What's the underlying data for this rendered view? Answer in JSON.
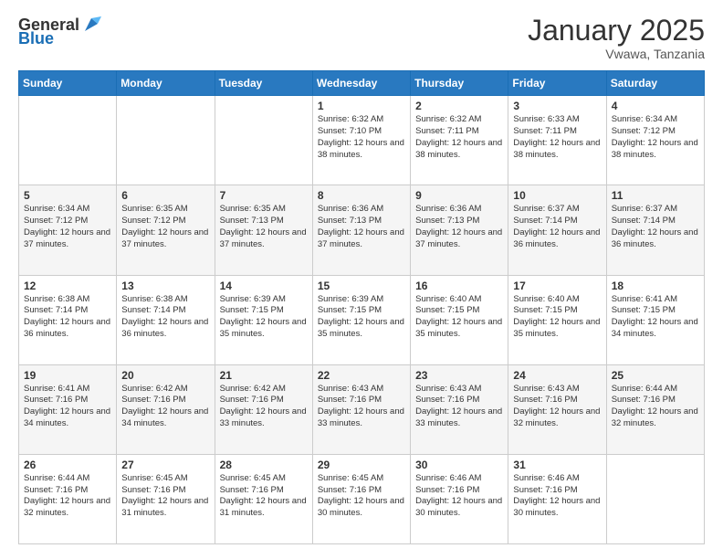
{
  "header": {
    "logo_general": "General",
    "logo_blue": "Blue",
    "month_title": "January 2025",
    "location": "Vwawa, Tanzania"
  },
  "columns": [
    "Sunday",
    "Monday",
    "Tuesday",
    "Wednesday",
    "Thursday",
    "Friday",
    "Saturday"
  ],
  "weeks": [
    [
      {
        "day": "",
        "info": ""
      },
      {
        "day": "",
        "info": ""
      },
      {
        "day": "",
        "info": ""
      },
      {
        "day": "1",
        "info": "Sunrise: 6:32 AM\nSunset: 7:10 PM\nDaylight: 12 hours and 38 minutes."
      },
      {
        "day": "2",
        "info": "Sunrise: 6:32 AM\nSunset: 7:11 PM\nDaylight: 12 hours and 38 minutes."
      },
      {
        "day": "3",
        "info": "Sunrise: 6:33 AM\nSunset: 7:11 PM\nDaylight: 12 hours and 38 minutes."
      },
      {
        "day": "4",
        "info": "Sunrise: 6:34 AM\nSunset: 7:12 PM\nDaylight: 12 hours and 38 minutes."
      }
    ],
    [
      {
        "day": "5",
        "info": "Sunrise: 6:34 AM\nSunset: 7:12 PM\nDaylight: 12 hours and 37 minutes."
      },
      {
        "day": "6",
        "info": "Sunrise: 6:35 AM\nSunset: 7:12 PM\nDaylight: 12 hours and 37 minutes."
      },
      {
        "day": "7",
        "info": "Sunrise: 6:35 AM\nSunset: 7:13 PM\nDaylight: 12 hours and 37 minutes."
      },
      {
        "day": "8",
        "info": "Sunrise: 6:36 AM\nSunset: 7:13 PM\nDaylight: 12 hours and 37 minutes."
      },
      {
        "day": "9",
        "info": "Sunrise: 6:36 AM\nSunset: 7:13 PM\nDaylight: 12 hours and 37 minutes."
      },
      {
        "day": "10",
        "info": "Sunrise: 6:37 AM\nSunset: 7:14 PM\nDaylight: 12 hours and 36 minutes."
      },
      {
        "day": "11",
        "info": "Sunrise: 6:37 AM\nSunset: 7:14 PM\nDaylight: 12 hours and 36 minutes."
      }
    ],
    [
      {
        "day": "12",
        "info": "Sunrise: 6:38 AM\nSunset: 7:14 PM\nDaylight: 12 hours and 36 minutes."
      },
      {
        "day": "13",
        "info": "Sunrise: 6:38 AM\nSunset: 7:14 PM\nDaylight: 12 hours and 36 minutes."
      },
      {
        "day": "14",
        "info": "Sunrise: 6:39 AM\nSunset: 7:15 PM\nDaylight: 12 hours and 35 minutes."
      },
      {
        "day": "15",
        "info": "Sunrise: 6:39 AM\nSunset: 7:15 PM\nDaylight: 12 hours and 35 minutes."
      },
      {
        "day": "16",
        "info": "Sunrise: 6:40 AM\nSunset: 7:15 PM\nDaylight: 12 hours and 35 minutes."
      },
      {
        "day": "17",
        "info": "Sunrise: 6:40 AM\nSunset: 7:15 PM\nDaylight: 12 hours and 35 minutes."
      },
      {
        "day": "18",
        "info": "Sunrise: 6:41 AM\nSunset: 7:15 PM\nDaylight: 12 hours and 34 minutes."
      }
    ],
    [
      {
        "day": "19",
        "info": "Sunrise: 6:41 AM\nSunset: 7:16 PM\nDaylight: 12 hours and 34 minutes."
      },
      {
        "day": "20",
        "info": "Sunrise: 6:42 AM\nSunset: 7:16 PM\nDaylight: 12 hours and 34 minutes."
      },
      {
        "day": "21",
        "info": "Sunrise: 6:42 AM\nSunset: 7:16 PM\nDaylight: 12 hours and 33 minutes."
      },
      {
        "day": "22",
        "info": "Sunrise: 6:43 AM\nSunset: 7:16 PM\nDaylight: 12 hours and 33 minutes."
      },
      {
        "day": "23",
        "info": "Sunrise: 6:43 AM\nSunset: 7:16 PM\nDaylight: 12 hours and 33 minutes."
      },
      {
        "day": "24",
        "info": "Sunrise: 6:43 AM\nSunset: 7:16 PM\nDaylight: 12 hours and 32 minutes."
      },
      {
        "day": "25",
        "info": "Sunrise: 6:44 AM\nSunset: 7:16 PM\nDaylight: 12 hours and 32 minutes."
      }
    ],
    [
      {
        "day": "26",
        "info": "Sunrise: 6:44 AM\nSunset: 7:16 PM\nDaylight: 12 hours and 32 minutes."
      },
      {
        "day": "27",
        "info": "Sunrise: 6:45 AM\nSunset: 7:16 PM\nDaylight: 12 hours and 31 minutes."
      },
      {
        "day": "28",
        "info": "Sunrise: 6:45 AM\nSunset: 7:16 PM\nDaylight: 12 hours and 31 minutes."
      },
      {
        "day": "29",
        "info": "Sunrise: 6:45 AM\nSunset: 7:16 PM\nDaylight: 12 hours and 30 minutes."
      },
      {
        "day": "30",
        "info": "Sunrise: 6:46 AM\nSunset: 7:16 PM\nDaylight: 12 hours and 30 minutes."
      },
      {
        "day": "31",
        "info": "Sunrise: 6:46 AM\nSunset: 7:16 PM\nDaylight: 12 hours and 30 minutes."
      },
      {
        "day": "",
        "info": ""
      }
    ]
  ]
}
